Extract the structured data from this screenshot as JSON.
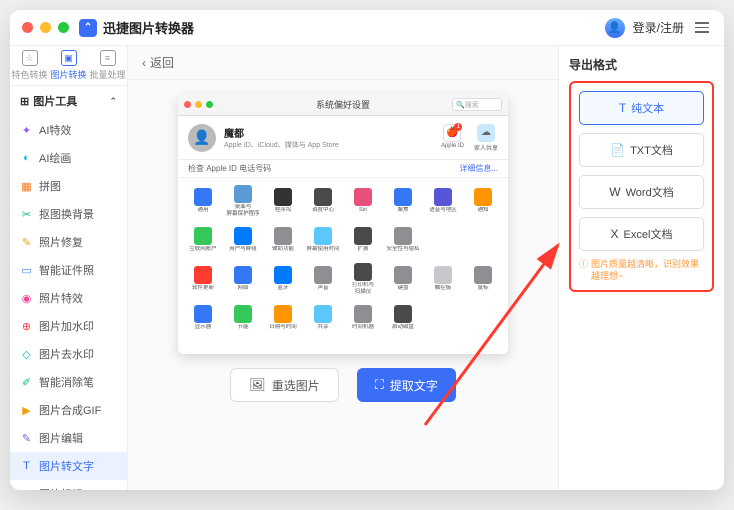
{
  "app": {
    "title": "迅捷图片转换器",
    "login": "登录/注册"
  },
  "tabs": {
    "t1": "特色转换",
    "t2": "图片转换",
    "t3": "批量处理"
  },
  "section": {
    "title": "图片工具"
  },
  "menu": [
    {
      "icon": "✦",
      "color": "#8b5cf6",
      "label": "AI特效"
    },
    {
      "icon": "◐",
      "color": "#06b6d4",
      "label": "AI绘画"
    },
    {
      "icon": "▦",
      "color": "#f97316",
      "label": "拼图"
    },
    {
      "icon": "✂",
      "color": "#10b981",
      "label": "抠图换背景"
    },
    {
      "icon": "✎",
      "color": "#f59e0b",
      "label": "照片修复"
    },
    {
      "icon": "▭",
      "color": "#3b82f6",
      "label": "智能证件照"
    },
    {
      "icon": "◉",
      "color": "#ec4899",
      "label": "照片特效"
    },
    {
      "icon": "⊕",
      "color": "#ef4444",
      "label": "图片加水印"
    },
    {
      "icon": "◇",
      "color": "#06b6d4",
      "label": "图片去水印"
    },
    {
      "icon": "✐",
      "color": "#10b981",
      "label": "智能消除笔"
    },
    {
      "icon": "▶",
      "color": "#f59e0b",
      "label": "图片合成GIF"
    },
    {
      "icon": "✎",
      "color": "#6366f1",
      "label": "图片编辑"
    },
    {
      "icon": "T",
      "color": "#3b6ef6",
      "label": "图片转文字"
    },
    {
      "icon": "◧",
      "color": "#14b8a6",
      "label": "图片标记"
    }
  ],
  "back": "返回",
  "preview": {
    "title": "系统偏好设置",
    "search_ph": "搜索",
    "user": "魔都",
    "user_sub": "Apple ID、iCloud、媒体与 App Store",
    "ri1": "Apple ID",
    "ri2": "家人共享",
    "sub_left": "检查 Apple ID 电话号码",
    "sub_right": "详细信息...",
    "grid": [
      {
        "c": "#3478f6",
        "l": "通用"
      },
      {
        "c": "#5b9bd5",
        "l": "桌面与\n屏幕保护程序"
      },
      {
        "c": "#333",
        "l": "程序坞"
      },
      {
        "c": "#4a4a4a",
        "l": "调度中心"
      },
      {
        "c": "#e8507a",
        "l": "Siri"
      },
      {
        "c": "#3478f6",
        "l": "聚焦"
      },
      {
        "c": "#5856d6",
        "l": "语音与地区"
      },
      {
        "c": "#ff9500",
        "l": "通知"
      },
      {
        "c": "#34c759",
        "l": "互联网账户"
      },
      {
        "c": "#007aff",
        "l": "用户与群组"
      },
      {
        "c": "#8e8e93",
        "l": "辅助功能"
      },
      {
        "c": "#5ac8fa",
        "l": "屏幕使用时间"
      },
      {
        "c": "#4a4a4a",
        "l": "扩展"
      },
      {
        "c": "#8e8e93",
        "l": "安全性与隐私"
      },
      {
        "c": "",
        "l": ""
      },
      {
        "c": "",
        "l": ""
      },
      {
        "c": "#ff3b30",
        "l": "软件更新"
      },
      {
        "c": "#3478f6",
        "l": "网络"
      },
      {
        "c": "#007aff",
        "l": "蓝牙"
      },
      {
        "c": "#8e8e93",
        "l": "声音"
      },
      {
        "c": "#4a4a4a",
        "l": "打印机与\n扫描仪"
      },
      {
        "c": "#8e8e93",
        "l": "键盘"
      },
      {
        "c": "#c7c7cc",
        "l": "触控板"
      },
      {
        "c": "#8e8e93",
        "l": "鼠标"
      },
      {
        "c": "#3478f6",
        "l": "显示器"
      },
      {
        "c": "#34c759",
        "l": "节能"
      },
      {
        "c": "#ff9500",
        "l": "日期与时间"
      },
      {
        "c": "#5ac8fa",
        "l": "共享"
      },
      {
        "c": "#8e8e93",
        "l": "时间机器"
      },
      {
        "c": "#4a4a4a",
        "l": "启动磁盘"
      },
      {
        "c": "",
        "l": ""
      },
      {
        "c": "",
        "l": ""
      }
    ]
  },
  "actions": {
    "reselect": "重选图片",
    "extract": "提取文字"
  },
  "right": {
    "title": "导出格式",
    "formats": [
      {
        "icon": "T",
        "label": "纯文本"
      },
      {
        "icon": "📄",
        "label": "TXT文档"
      },
      {
        "icon": "W",
        "label": "Word文档"
      },
      {
        "icon": "X",
        "label": "Excel文档"
      }
    ],
    "hint": "图片质量越清晰，识别效果越理想~"
  }
}
